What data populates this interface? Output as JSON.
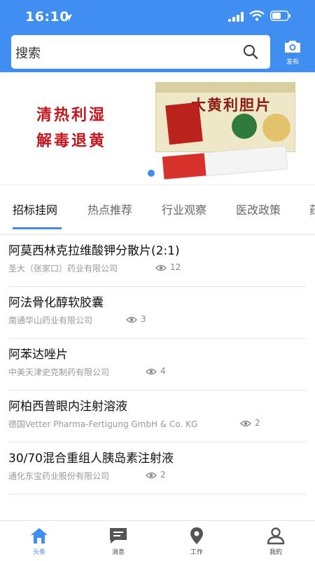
{
  "status_bar": {
    "time": "16:10"
  },
  "search": {
    "placeholder": "搜索"
  },
  "header": {
    "publish_label": "发布"
  },
  "banner": {
    "line1": "清热利湿",
    "line2": "解毒退黄",
    "product_name": "大黄利胆片"
  },
  "tabs": [
    "招标挂网",
    "热点推荐",
    "行业观察",
    "医改政策",
    "药"
  ],
  "items": [
    {
      "title": "阿莫西林克拉维酸钾分散片(2:1)",
      "company": "圣大（张家口）药业有限公司",
      "views": "12"
    },
    {
      "title": "阿法骨化醇软胶囊",
      "company": "南通华山药业有限公司",
      "views": "3"
    },
    {
      "title": "阿苯达唑片",
      "company": "中美天津史克制药有限公司",
      "views": "4"
    },
    {
      "title": "阿柏西普眼内注射溶液",
      "company": "德国Vetter Pharma-Fertigung GmbH & Co. KG",
      "views": "2"
    },
    {
      "title": "30/70混合重组人胰岛素注射液",
      "company": "通化东宝药业股份有限公司",
      "views": "2"
    }
  ],
  "bottom_nav": [
    "头条",
    "消息",
    "工作",
    "我的"
  ],
  "colors": {
    "accent": "#3f8ff0",
    "banner_red": "#c4161c"
  }
}
